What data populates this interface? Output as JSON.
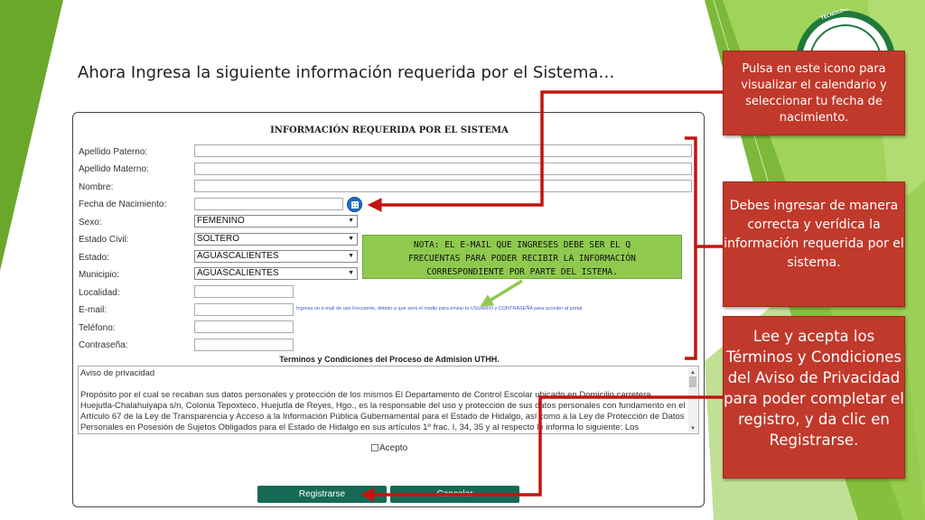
{
  "slide_title": "Ahora Ingresa la siguiente información requerida por el Sistema…",
  "logo": {
    "seal_text": "TECNOLÓGICA DE LA HUASTECA H",
    "icon": "university-seal-logo"
  },
  "form": {
    "title": "INFORMACIÓN REQUERIDA POR EL SISTEMA",
    "labels": {
      "apellido_paterno": "Apellido Paterno:",
      "apellido_materno": "Apellido Materno:",
      "nombre": "Nombre:",
      "fecha_nacimiento": "Fecha de Nacimiento:",
      "sexo": "Sexo:",
      "estado_civil": "Estado Civil:",
      "estado": "Estado:",
      "municipio": "Municipio:",
      "localidad": "Localidad:",
      "email": "E-mail:",
      "telefono": "Teléfono:",
      "contrasena": "Contraseña:"
    },
    "values": {
      "sexo": "FEMENINO",
      "estado_civil": "SOLTERO",
      "estado": "AGUASCALIENTES",
      "municipio": "AGUASCALIENTES"
    },
    "calendar_icon": "calendar-icon",
    "email_hint": "Ingresa un e-mail de uso Frecuente, debido a que será el medio para enviar tu USUARIO y CONTRASEÑA para acceder al portal.",
    "note": {
      "line1": "NOTA: EL E-MAIL QUE INGRESES DEBE SER EL Q",
      "line2": "FRECUENTAS PARA PODER RECIBIR LA INFORMACIÓN",
      "line3": "CORRESPONDIENTE POR PARTE DEL ISTEMA."
    },
    "terms_title": "Terminos y Condiciones del Proceso de Admision UTHH.",
    "terms_heading": "Aviso de privacidad",
    "terms_body": "Propósito por el cual se recaban sus datos personales y protección de los mismos El Departamento de Control Escolar ubicado en Domicilio carretera Huejutla-Chalahuiyapa s/n, Colonia Tepoxteco, Huejutla de Reyes, Hgo., es la responsable del uso y protección de sus datos personales con fundamento en el Artículo 67 de la Ley de Transparencia y Acceso a la Información Pública Gubernamental para el Estado de Hidalgo, así como a la Ley de Protección de Datos Personales en Posesión de Sujetos Obligados para el Estado de Hidalgo en sus artículos 1º frac. I, 34, 35 y al respecto le informa lo siguiente: Los",
    "accept_label": "Acepto",
    "register_button": "Registrarse",
    "cancel_button": "Cancelar"
  },
  "callouts": {
    "calendar_tip": "Pulsa en este icono para visualizar el calendario y seleccionar tu fecha de nacimiento.",
    "info_tip": "Debes ingresar de manera correcta y verídica la información requerida por el sistema.",
    "terms_tip": "Lee y acepta los Términos y Condiciones del Aviso de Privacidad para poder completar el registro, y da clic en Registrarse."
  },
  "colors": {
    "green_dark": "#6aa82c",
    "green_light": "#9fd35a",
    "callout_red": "#c0392b",
    "arrow_red": "#c0150f",
    "button_green": "#166a55",
    "note_green": "#8fca4f"
  }
}
